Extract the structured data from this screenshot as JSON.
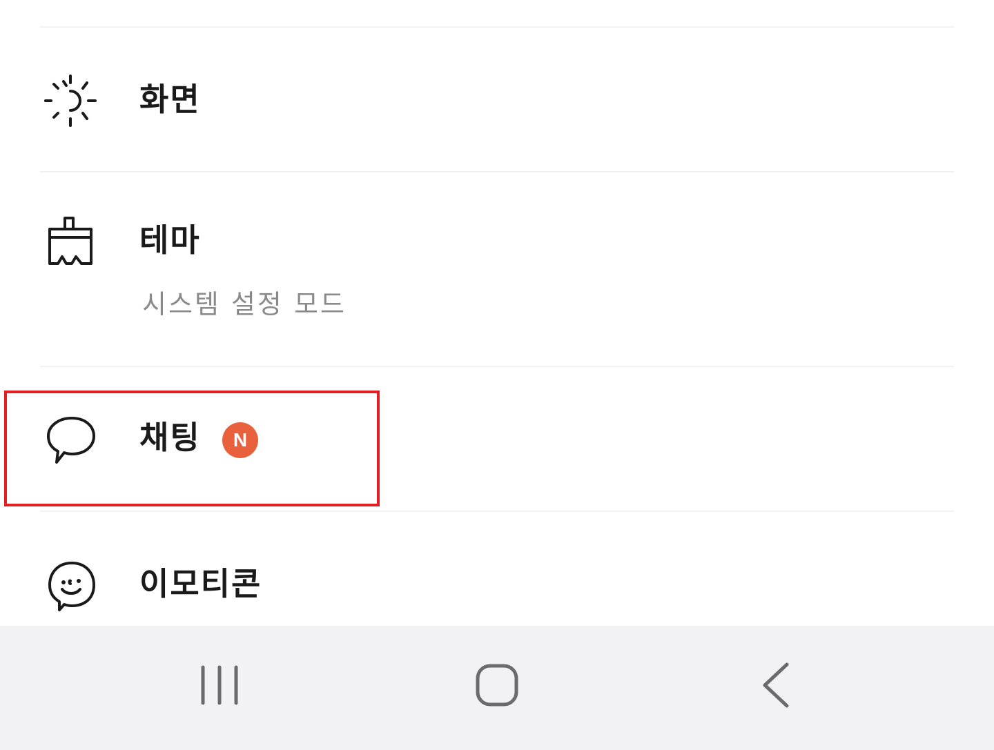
{
  "settings_menu": {
    "items": [
      {
        "label": "화면",
        "icon": "sun-icon"
      },
      {
        "label": "테마",
        "sublabel": "시스템 설정 모드",
        "icon": "paintbrush-icon"
      },
      {
        "label": "채팅",
        "badge": "N",
        "icon": "chat-bubble-icon",
        "highlighted": true
      },
      {
        "label": "이모티콘",
        "icon": "emoticon-icon"
      }
    ]
  },
  "colors": {
    "badge": "#e8603c",
    "highlight_border": "#e31e24",
    "nav_bar_bg": "#f2f2f4",
    "sublabel": "#8a8a8a"
  },
  "nav_bar": {
    "buttons": [
      {
        "icon": "recent-apps-icon"
      },
      {
        "icon": "home-icon"
      },
      {
        "icon": "back-icon"
      }
    ]
  }
}
